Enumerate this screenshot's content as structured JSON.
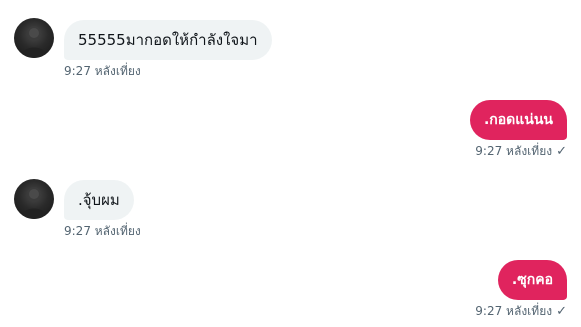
{
  "messages": [
    {
      "direction": "incoming",
      "text": "55555มากอดให้กำลังใจมา",
      "time": "9:27 หลังเที่ยง"
    },
    {
      "direction": "outgoing",
      "text": ".กอดแน่นน",
      "time": "9:27 หลังเที่ยง",
      "read_icon": "✓"
    },
    {
      "direction": "incoming",
      "text": ".จุ้บผม",
      "time": "9:27 หลังเที่ยง"
    },
    {
      "direction": "outgoing",
      "text": ".ซุกคอ",
      "time": "9:27 หลังเที่ยง",
      "read_icon": "✓"
    }
  ],
  "colors": {
    "incoming_bubble": "#eff3f4",
    "outgoing_bubble": "#e0245e",
    "meta_text": "#536471"
  },
  "icons": {
    "avatar": "avatar-image",
    "sent": "check-icon"
  }
}
